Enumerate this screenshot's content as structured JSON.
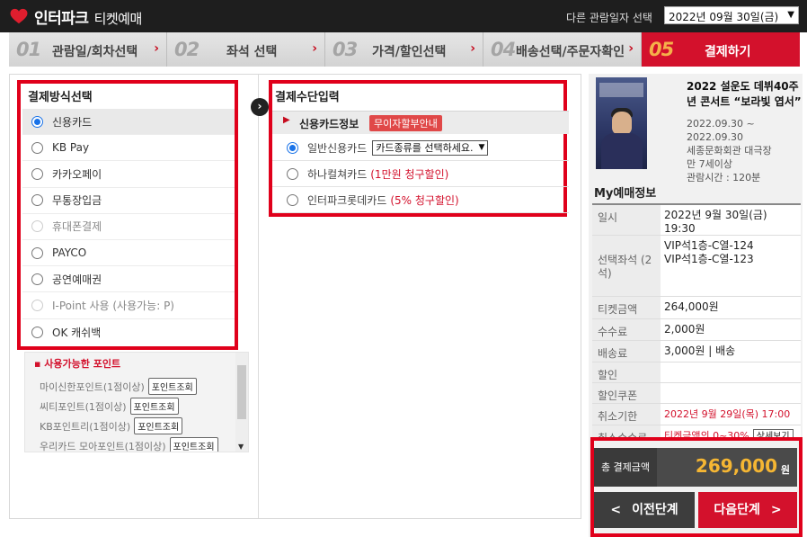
{
  "header": {
    "logo_text": "인터파크",
    "logo_sub": "티켓예매",
    "date_label": "다른 관람일자 선택",
    "date_value": "2022년 09월 30일(금)"
  },
  "steps": [
    {
      "num": "01",
      "label": "관람일/회차선택"
    },
    {
      "num": "02",
      "label": "좌석 선택"
    },
    {
      "num": "03",
      "label": "가격/할인선택"
    },
    {
      "num": "04",
      "label": "배송선택/주문자확인"
    },
    {
      "num": "05",
      "label": "결제하기"
    }
  ],
  "payment_methods": {
    "title": "결제방식선택",
    "items": [
      {
        "label": "신용카드",
        "state": "selected"
      },
      {
        "label": "KB Pay",
        "state": "normal"
      },
      {
        "label": "카카오페이",
        "state": "normal"
      },
      {
        "label": "무통장입금",
        "state": "normal"
      },
      {
        "label": "휴대폰결제",
        "state": "disabled"
      },
      {
        "label": "PAYCO",
        "state": "normal"
      },
      {
        "label": "공연예매권",
        "state": "normal"
      },
      {
        "label": "I-Point 사용 (사용가능: P)",
        "state": "disabled"
      },
      {
        "label": "OK 캐쉬백",
        "state": "normal"
      }
    ]
  },
  "points": {
    "title": "사용가능한 포인트",
    "button_label": "포인트조회",
    "rows": [
      "마이신한포인트(1점이상)",
      "씨티포인트(1점이상)",
      "KB포인트리(1점이상)",
      "우리카드 모아포인트(1점이상)"
    ]
  },
  "payment_input": {
    "title": "결제수단입력",
    "card_info_label": "신용카드정보",
    "installment_badge": "무이자할부안내",
    "general_card": "일반신용카드",
    "card_select_placeholder": "카드종류를 선택하세요.",
    "hana_card": "하나컬쳐카드",
    "hana_discount": "(1만원 청구할인)",
    "interpark_card": "인터파크롯데카드",
    "interpark_discount": "(5% 청구할인)"
  },
  "show": {
    "title": "2022 설운도 데뷔40주년 콘서트 “보라빛 엽서”",
    "date_range": "2022.09.30 ~ 2022.09.30",
    "venue": "세종문화회관 대극장",
    "age": "만 7세이상",
    "runtime": "관람시간 : 120분"
  },
  "my_booking": {
    "title": "My예매정보",
    "rows": [
      {
        "key": "일시",
        "value": "2022년 9월 30일(금) 19:30"
      },
      {
        "key": "선택좌석 (2석)",
        "value": "VIP석1층-C열-124\nVIP석1층-C열-123"
      },
      {
        "key": "티켓금액",
        "value": "264,000원"
      },
      {
        "key": "수수료",
        "value": "2,000원"
      },
      {
        "key": "배송료",
        "value": "3,000원 | 배송"
      },
      {
        "key": "할인",
        "value": ""
      },
      {
        "key": "할인쿠폰",
        "value": ""
      },
      {
        "key": "취소기한",
        "value": "2022년 9월 29일(목) 17:00"
      },
      {
        "key": "취소수수료",
        "value": "티켓금액의 0~30%"
      }
    ],
    "detail_button": "상세보기"
  },
  "total": {
    "label": "총 결제금액",
    "amount": "269,000",
    "unit": "원"
  },
  "nav": {
    "prev": "이전단계",
    "next": "다음단계"
  },
  "colors": {
    "brand_red": "#d3112c",
    "header_bg": "#1e1e1e",
    "total_amount": "#f5b633"
  }
}
